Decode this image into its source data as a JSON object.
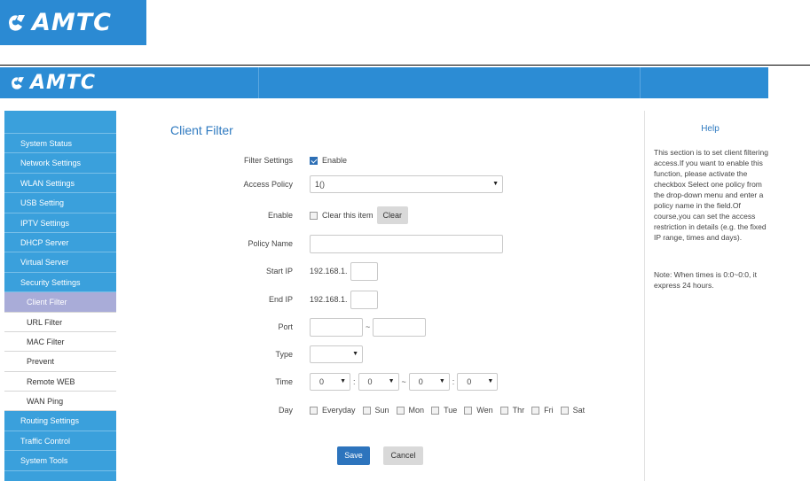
{
  "brand": {
    "name": "AMTC",
    "color": "#2b8ad3",
    "icon": "amtc-logo-icon"
  },
  "sidebar": {
    "items": [
      {
        "label": "System Status"
      },
      {
        "label": "Network Settings"
      },
      {
        "label": "WLAN Settings"
      },
      {
        "label": "USB Setting"
      },
      {
        "label": "IPTV Settings"
      },
      {
        "label": "DHCP Server"
      },
      {
        "label": "Virtual Server"
      },
      {
        "label": "Security Settings"
      },
      {
        "label": "Client Filter",
        "active": true
      },
      {
        "label": "URL Filter"
      },
      {
        "label": "MAC Filter"
      },
      {
        "label": "Prevent"
      },
      {
        "label": "Remote WEB"
      },
      {
        "label": "WAN Ping"
      },
      {
        "label": "Routing Settings"
      },
      {
        "label": "Traffic Control"
      },
      {
        "label": "System Tools"
      }
    ]
  },
  "main": {
    "title": "Client Filter",
    "filter_settings": {
      "label": "Filter Settings",
      "checkbox_label": "Enable",
      "checked": true
    },
    "access_policy": {
      "label": "Access Policy",
      "value": "1()"
    },
    "enable": {
      "label": "Enable",
      "checkbox_label": "Clear this item",
      "checked": false,
      "clear_button": "Clear"
    },
    "policy_name": {
      "label": "Policy Name",
      "value": ""
    },
    "start_ip": {
      "label": "Start IP",
      "prefix": "192.168.1.",
      "value": ""
    },
    "end_ip": {
      "label": "End IP",
      "prefix": "192.168.1.",
      "value": ""
    },
    "port": {
      "label": "Port",
      "separator": "~",
      "from": "",
      "to": ""
    },
    "type": {
      "label": "Type",
      "value": ""
    },
    "time": {
      "label": "Time",
      "start_hour": "0",
      "start_min": "0",
      "separator_colon": ":",
      "separator_range": "~",
      "end_hour": "0",
      "end_min": "0"
    },
    "day": {
      "label": "Day",
      "options": [
        "Everyday",
        "Sun",
        "Mon",
        "Tue",
        "Wen",
        "Thr",
        "Fri",
        "Sat"
      ]
    },
    "save_button": "Save",
    "cancel_button": "Cancel"
  },
  "help": {
    "title": "Help",
    "text": "This section is to set client filtering access.If you want to enable this function, please activate the checkbox Select one policy from the drop-down menu and enter a policy name in the field.Of course,you can set the access restriction in details (e.g. the fixed IP range, times and days).",
    "note": "Note: When times is 0:0~0:0, it express 24 hours."
  },
  "colors": {
    "header": "#2c8cd4",
    "sidebar": "#3aa0dc",
    "active_item": "#a9acd8",
    "save": "#2d74bd"
  }
}
